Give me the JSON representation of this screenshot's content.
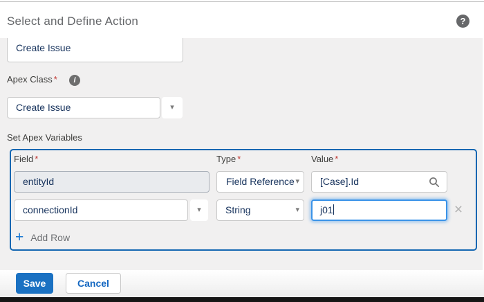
{
  "header": {
    "title": "Select and Define Action",
    "help_icon_glyph": "?"
  },
  "form": {
    "action_search_value": "Create Issue",
    "apex_class": {
      "label": "Apex Class",
      "required_mark": "*",
      "info_icon_glyph": "i",
      "value": "Create Issue"
    },
    "variables": {
      "section_label": "Set Apex Variables",
      "columns": {
        "field": "Field",
        "type": "Type",
        "value": "Value"
      },
      "required_mark": "*",
      "rows": [
        {
          "field": "entityId",
          "type": "Field Reference",
          "value": "[Case].Id"
        },
        {
          "field": "connectionId",
          "type": "String",
          "value": "j01"
        }
      ],
      "close_icon_glyph": "×",
      "add_row": {
        "plus_glyph": "+",
        "label": "Add Row"
      }
    }
  },
  "footer": {
    "save_label": "Save",
    "cancel_label": "Cancel"
  },
  "colors": {
    "accent_blue": "#1467b2",
    "focus_blue": "#3a93e8",
    "brand_button": "#1a71c2",
    "link_blue": "#1467c1",
    "required_red": "#c23934",
    "value_text": "#16325c",
    "panel_grey": "#f1f0f0"
  }
}
